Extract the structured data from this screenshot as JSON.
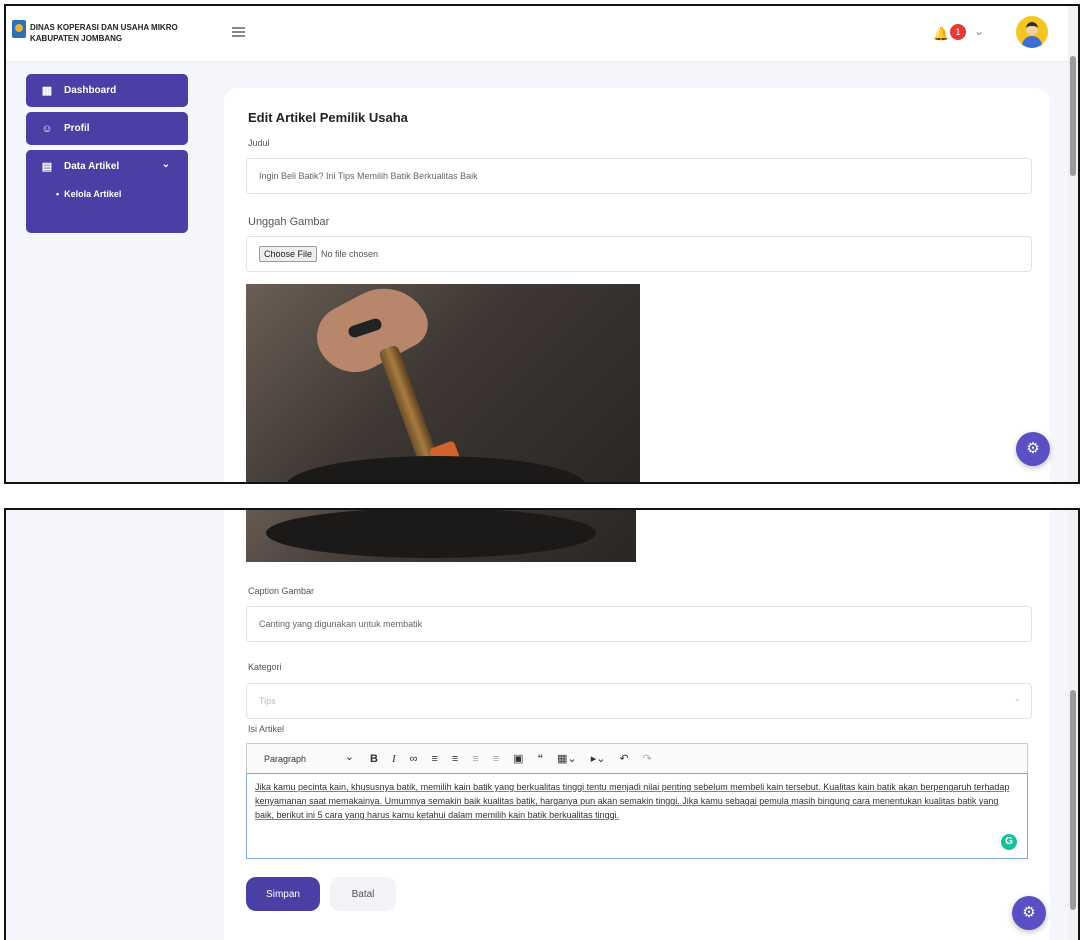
{
  "header": {
    "brand_line1": "DINAS KOPERASI DAN USAHA MIKRO",
    "brand_line2": "KABUPATEN JOMBANG",
    "notification_count": "1"
  },
  "sidebar": {
    "items": [
      {
        "label": "Dashboard",
        "icon": "grid-icon"
      },
      {
        "label": "Profil",
        "icon": "user-icon"
      },
      {
        "label": "Data Artikel",
        "icon": "document-icon"
      }
    ],
    "sub_items": [
      {
        "label": "Kelola Artikel"
      }
    ]
  },
  "form": {
    "title": "Edit Artikel Pemilik Usaha",
    "judul_label": "Judul",
    "judul_value": "Ingin Beli Batik? Ini Tips Memilih Batik Berkualitas Baik",
    "upload_label": "Unggah Gambar",
    "choose_file": "Choose File",
    "no_file": "No file chosen",
    "caption_label": "Caption Gambar",
    "caption_value": "Canting yang digunakan untuk membatik",
    "kategori_label": "Kategori",
    "kategori_value": "Tips",
    "isi_label": "Isi Artikel",
    "paragraph_select": "Paragraph",
    "body_text": "Jika kamu pecinta kain, khususnya batik, memilih kain batik yang berkualitas tinggi tentu menjadi nilai penting sebelum membeli kain tersebut. Kualitas kain batik akan berpengaruh terhadap kenyamanan saat memakainya. Umumnya semakin baik kualitas batik, harganya pun akan semakin tinggi. Jika kamu sebagai pemula masih bingung cara menentukan kualitas batik yang baik, berikut ini 5 cara yang harus kamu ketahui dalam memilih kain batik berkualitas tinggi.",
    "save_label": "Simpan",
    "cancel_label": "Batal"
  },
  "colors": {
    "primary": "#4a3fa4",
    "fab": "#5b4fc4",
    "badge": "#e53935"
  }
}
